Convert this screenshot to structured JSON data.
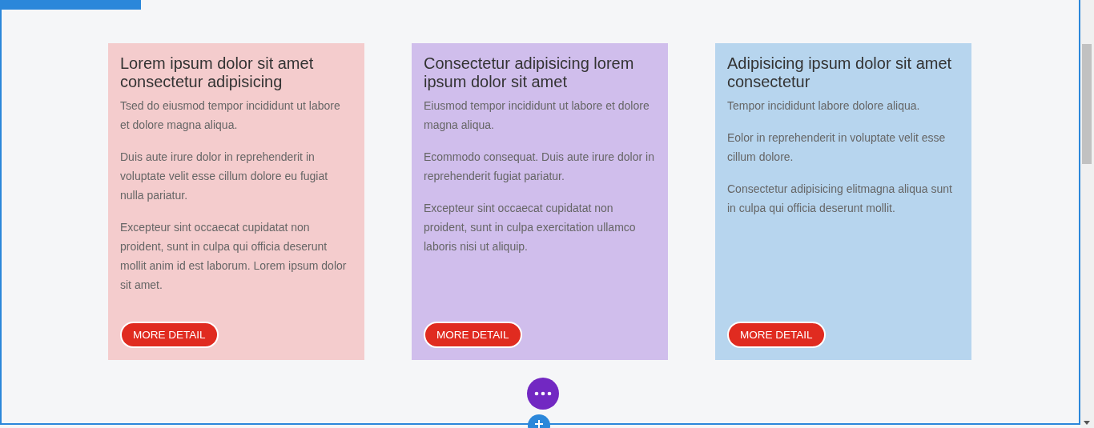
{
  "cards": [
    {
      "color": "#f4cccd",
      "title": "Lorem ipsum dolor sit amet consectetur adipisicing",
      "paragraphs": [
        "Tsed do eiusmod tempor incididunt ut labore et dolore magna aliqua.",
        "Duis aute irure dolor in reprehenderit in voluptate velit esse cillum dolore eu fugiat nulla pariatur.",
        "Excepteur sint occaecat cupidatat non proident, sunt in culpa qui officia deserunt mollit anim id est laborum. Lorem ipsum dolor sit amet."
      ],
      "button": "MORE DETAIL"
    },
    {
      "color": "#d0beec",
      "title": "Consectetur adipisicing lorem ipsum dolor sit amet",
      "paragraphs": [
        "Eiusmod tempor incididunt ut labore et dolore magna aliqua.",
        "Ecommodo consequat. Duis aute irure dolor in reprehenderit  fugiat pariatur.",
        "Excepteur sint occaecat cupidatat non proident, sunt in culpa exercitation ullamco laboris nisi ut aliquip."
      ],
      "button": "MORE DETAIL"
    },
    {
      "color": "#b7d5ee",
      "title": "Adipisicing ipsum dolor sit amet consectetur",
      "paragraphs": [
        "Tempor incididunt labore dolore aliqua.",
        "Eolor in reprehenderit in voluptate velit esse cillum dolore.",
        "Consectetur adipisicing elitmagna aliqua sunt in culpa qui officia deserunt mollit."
      ],
      "button": "MORE DETAIL"
    }
  ]
}
